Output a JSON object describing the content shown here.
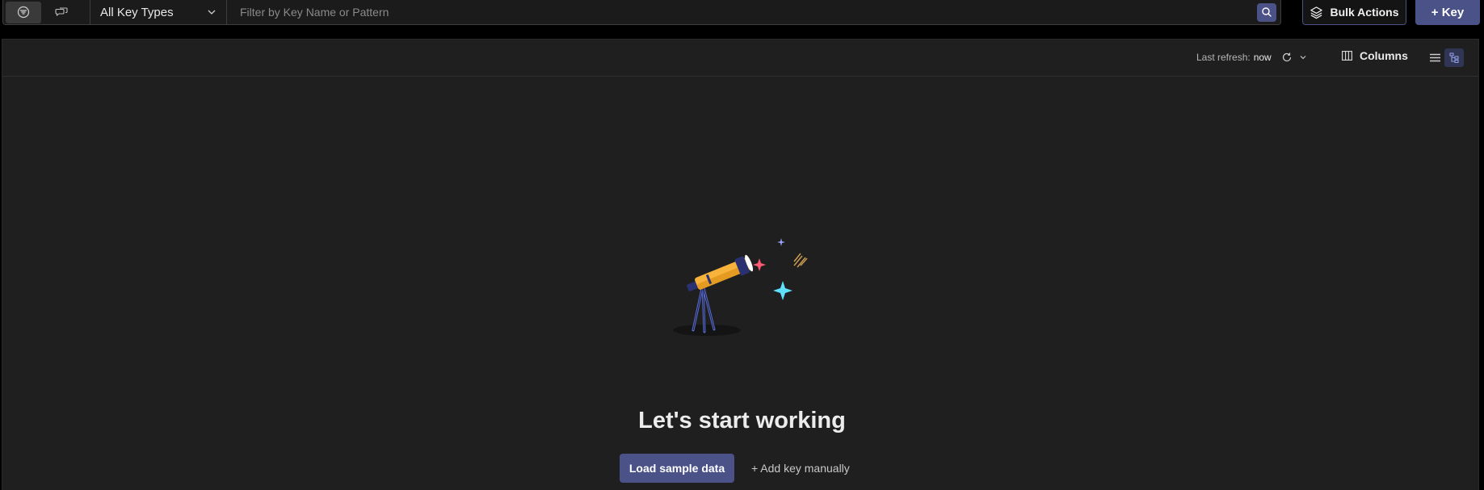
{
  "filter": {
    "key_type": "All Key Types",
    "search_placeholder": "Filter by Key Name or Pattern"
  },
  "toolbar": {
    "bulk_actions_label": "Bulk Actions",
    "add_key_label": "+ Key"
  },
  "panel": {
    "refresh_label": "Last refresh:",
    "refresh_value": "now",
    "columns_label": "Columns"
  },
  "empty_state": {
    "headline": "Let's start working",
    "load_sample_label": "Load sample data",
    "add_manually_label": "+ Add key manually"
  },
  "icons": {
    "filter_mode": "filter-icon",
    "vector_mode": "chat-icon",
    "chevron": "chevron-down-icon",
    "search": "search-icon",
    "bulk": "layers-icon",
    "refresh": "refresh-icon",
    "columns": "columns-icon",
    "list_view": "list-view-icon",
    "tree_view": "tree-view-icon",
    "illustration": "telescope-icon"
  },
  "colors": {
    "accent": "#4a5288",
    "background": "#1f1f1f"
  }
}
